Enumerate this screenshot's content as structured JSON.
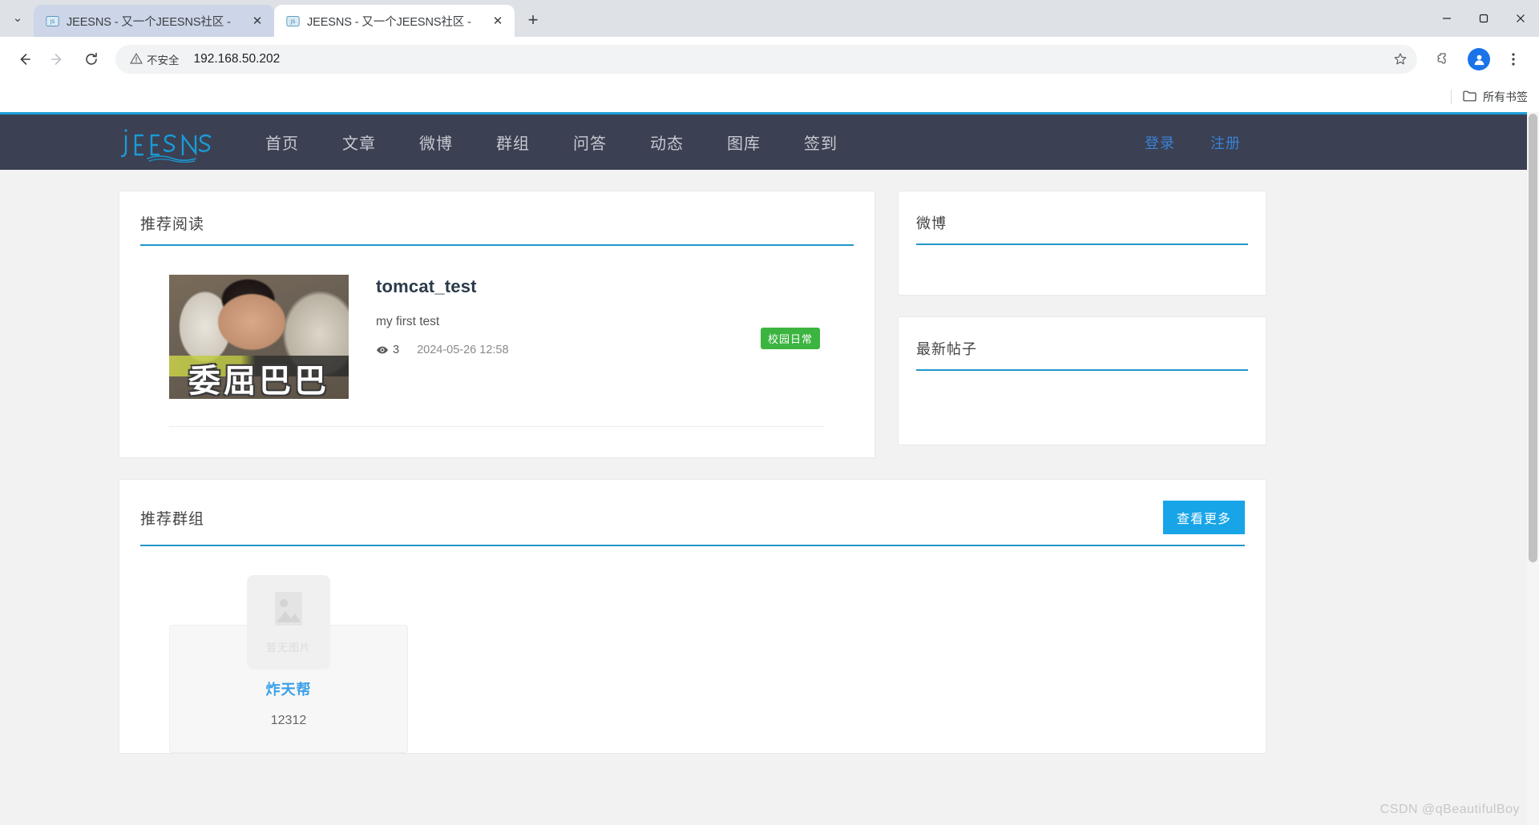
{
  "browser": {
    "tabs": [
      {
        "title": "JEESNS - 又一个JEESNS社区 -",
        "active": false,
        "favicon": "jeesns-favicon"
      },
      {
        "title": "JEESNS - 又一个JEESNS社区 -",
        "active": true,
        "favicon": "jeesns-favicon"
      }
    ],
    "new_tab_label": "+",
    "tab_close_label": "✕",
    "tab_search_label": "⌄",
    "window": {
      "minimize": "—",
      "maximize": "▢",
      "close": "✕"
    },
    "omnibox": {
      "security_label": "不安全",
      "url": "192.168.50.202"
    },
    "bookmarks": {
      "all_bookmarks_label": "所有书签"
    }
  },
  "site": {
    "logo_text": "JEESNS",
    "nav": [
      {
        "label": "首页"
      },
      {
        "label": "文章"
      },
      {
        "label": "微博"
      },
      {
        "label": "群组"
      },
      {
        "label": "问答"
      },
      {
        "label": "动态"
      },
      {
        "label": "图库"
      },
      {
        "label": "签到"
      }
    ],
    "auth": [
      {
        "label": "登录"
      },
      {
        "label": "注册"
      }
    ],
    "accent_color": "#2196c9",
    "nav_bg_color": "#3b4052",
    "button_color": "#18a5e8"
  },
  "recommended_reading": {
    "title": "推荐阅读",
    "article": {
      "title": "tomcat_test",
      "description": "my first test",
      "views": "3",
      "date": "2024-05-26 12:58",
      "tag": "校园日常",
      "tag_color": "#3cb440",
      "thumbnail_caption": "委屈巴巴"
    }
  },
  "sidebar": {
    "panels": [
      {
        "title": "微博"
      },
      {
        "title": "最新帖子"
      }
    ]
  },
  "recommended_groups": {
    "title": "推荐群组",
    "more_label": "查看更多",
    "groups": [
      {
        "name": "炸天帮",
        "description": "12312",
        "image_placeholder": "暂无图片"
      }
    ]
  },
  "watermark": "CSDN @qBeautifulBoy"
}
